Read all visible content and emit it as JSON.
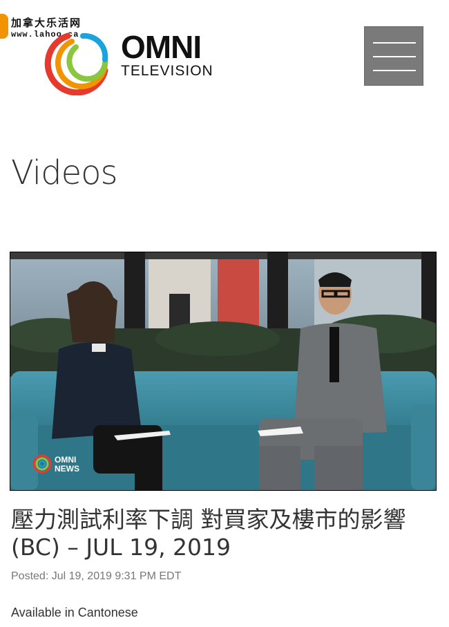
{
  "watermark": {
    "line1": "加拿大乐活网",
    "line2": "www.lahoo.ca"
  },
  "header": {
    "logo_name": "OMNI",
    "logo_subtitle": "TELEVISION",
    "menu_icon": "hamburger-menu-icon"
  },
  "page": {
    "title": "Videos"
  },
  "video": {
    "channel_bug": "OMNI NEWS",
    "title": "壓力測試利率下調 對買家及樓市的影響 (BC) – JUL 19, 2019",
    "posted": "Posted: Jul 19, 2019 9:31 PM EDT",
    "availability": "Available in Cantonese"
  },
  "colors": {
    "menu_button": "#7a7a7a",
    "sofa": "#3f8ea0",
    "accent_red": "#e63a2e",
    "accent_orange": "#f29400",
    "accent_green": "#8cc63f",
    "accent_blue": "#1aa3dd"
  }
}
